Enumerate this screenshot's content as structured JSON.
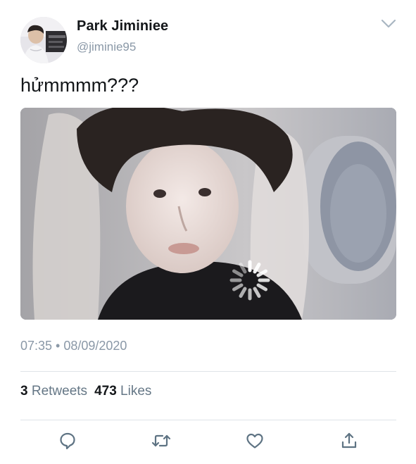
{
  "tweet": {
    "author": {
      "display_name": "Park Jiminiee",
      "handle": "@jiminie95"
    },
    "text": "hửmmmm???",
    "timestamp": "07:35 • 08/09/2020",
    "stats": {
      "retweets_count": "3",
      "retweets_label": "Retweets",
      "likes_count": "473",
      "likes_label": "Likes"
    },
    "media": {
      "loading": true
    }
  },
  "actions": {
    "reply_icon": "speech-bubble",
    "retweet_icon": "retweet-arrows",
    "like_icon": "heart-outline",
    "share_icon": "upload-arrow"
  },
  "colors": {
    "text_primary": "#14171a",
    "text_secondary": "#8a98a7",
    "icon_gray": "#5e7383",
    "divider": "#dfe4e8"
  }
}
